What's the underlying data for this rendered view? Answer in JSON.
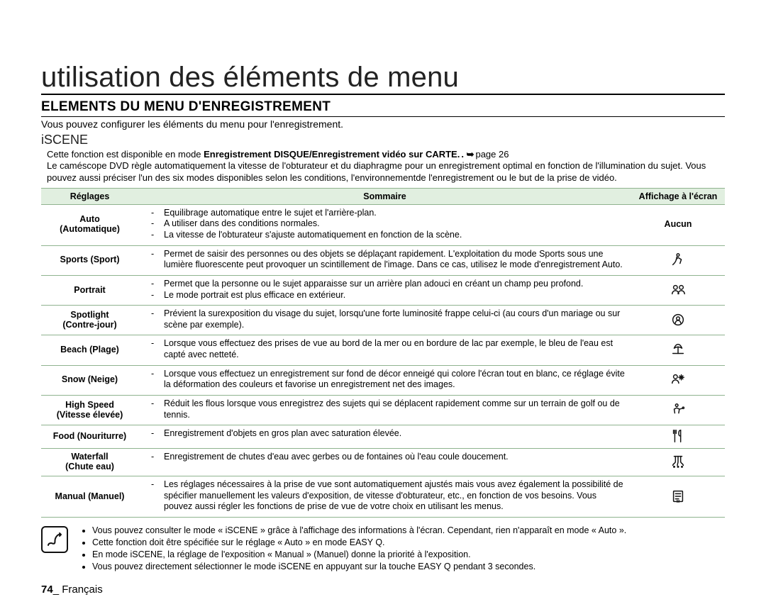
{
  "title": "utilisation des éléments de menu",
  "section_heading": "ELEMENTS DU MENU D'ENREGISTREMENT",
  "intro": "Vous pouvez configurer les éléments du menu pour l'enregistrement.",
  "subheading": "iSCENE",
  "availability": {
    "prefix": "Cette fonction est disponible en mode ",
    "bold": "Enregistrement DISQUE/Enregistrement vidéo sur CARTE.",
    "arrow": " . ➥",
    "page_ref": "page 26"
  },
  "description": "Le caméscope DVD règle automatiquement la vitesse de l'obturateur et du diaphragme pour un enregistrement optimal en fonction de l'illumination du sujet. Vous pouvez aussi préciser l'un des six modes disponibles selon les conditions, l'environnementde l'enregistrement ou le but de la prise de vidéo.",
  "table": {
    "headers": {
      "reglages": "Réglages",
      "sommaire": "Sommaire",
      "affichage": "Affichage à l'écran"
    },
    "rows": [
      {
        "reglage": "Auto\n(Automatique)",
        "affichage_text": "Aucun",
        "icon": null,
        "sommaire": [
          "Equilibrage automatique entre le sujet et l'arrière-plan.",
          "A utiliser dans des conditions normales.",
          "La vitesse de l'obturateur s'ajuste automatiquement en fonction de la scène."
        ]
      },
      {
        "reglage": "Sports (Sport)",
        "icon": "sports",
        "sommaire": [
          "Permet de saisir des personnes ou des objets se déplaçant rapidement. L'exploitation du mode Sports sous une lumière fluorescente peut provoquer un scintillement de l'image. Dans ce cas, utilisez le mode d'enregistrement Auto."
        ]
      },
      {
        "reglage": "Portrait",
        "icon": "portrait",
        "sommaire": [
          "Permet que la personne ou le sujet apparaisse sur un arrière plan adouci en créant un champ peu profond.",
          "Le mode portrait est plus efficace en extérieur."
        ]
      },
      {
        "reglage": "Spotlight\n(Contre-jour)",
        "icon": "spotlight",
        "sommaire": [
          "Prévient la surexposition du visage du sujet, lorsqu'une forte luminosité frappe celui-ci (au cours d'un mariage ou sur scène par exemple)."
        ]
      },
      {
        "reglage": "Beach (Plage)",
        "icon": "beach",
        "sommaire": [
          "Lorsque vous effectuez des prises de vue au bord de la mer ou en bordure de lac par exemple, le bleu de l'eau est capté avec netteté."
        ]
      },
      {
        "reglage": "Snow (Neige)",
        "icon": "snow",
        "sommaire": [
          "Lorsque vous effectuez un enregistrement sur fond de décor enneigé qui colore l'écran tout en blanc, ce réglage évite la déformation des couleurs et favorise un enregistrement net des images."
        ]
      },
      {
        "reglage": "High Speed\n(Vitesse élevée)",
        "icon": "highspeed",
        "sommaire": [
          "Réduit les flous lorsque vous enregistrez des sujets qui se déplacent rapidement comme sur un terrain de golf ou de tennis."
        ]
      },
      {
        "reglage": "Food (Nouriturre)",
        "icon": "food",
        "sommaire": [
          "Enregistrement d'objets en gros plan avec saturation élevée."
        ]
      },
      {
        "reglage": "Waterfall\n(Chute eau)",
        "icon": "waterfall",
        "sommaire": [
          "Enregistrement de chutes d'eau avec gerbes ou de fontaines où l'eau coule doucement."
        ]
      },
      {
        "reglage": "Manual (Manuel)",
        "icon": "manual",
        "sommaire": [
          "Les réglages nécessaires à la prise de vue sont automatiquement ajustés mais vous avez également la possibilité de spécifier manuellement les valeurs d'exposition, de vitesse d'obturateur, etc., en fonction de vos besoins. Vous pouvez aussi régler les fonctions de prise de vue de votre choix en utilisant les menus."
        ]
      }
    ]
  },
  "notes": [
    "Vous pouvez consulter le mode « iSCENE » grâce à l'affichage des informations à l'écran. Cependant, rien n'apparaît en mode « Auto ».",
    "Cette fonction doit être spécifiée sur le réglage « Auto » en mode EASY Q.",
    "En mode iSCENE, la réglage de l'exposition « Manual » (Manuel) donne la priorité à l'exposition.",
    "Vous pouvez directement sélectionner le mode iSCENE en appuyant sur la touche EASY Q pendant 3 secondes."
  ],
  "notes_formatted": [
    {
      "pre": "Vous pouvez consulter le mode « ",
      "b1": "iSCENE",
      "mid": " » grâce à l'affichage des informations à l'écran. Cependant, rien n'apparaît en mode « ",
      "b2": "Auto",
      "post": " »."
    },
    {
      "pre": "Cette fonction doit être spécifiée sur le réglage « ",
      "b1": "Auto",
      "mid": " » en mode EASY Q.",
      "b2": "",
      "post": ""
    },
    {
      "pre": "En mode iSCENE, la réglage de l'exposition « ",
      "b1": "Manual",
      "mid": " » (",
      "b2": "Manuel",
      "post": ") donne la priorité à l'exposition."
    },
    {
      "pre": "Vous pouvez directement sélectionner le mode iSCENE en appuyant sur la touche ",
      "b1": "EASY Q",
      "mid": " pendant 3 secondes.",
      "b2": "",
      "post": ""
    }
  ],
  "footer": {
    "page_number": "74",
    "sep": "_ ",
    "lang": "Français"
  }
}
